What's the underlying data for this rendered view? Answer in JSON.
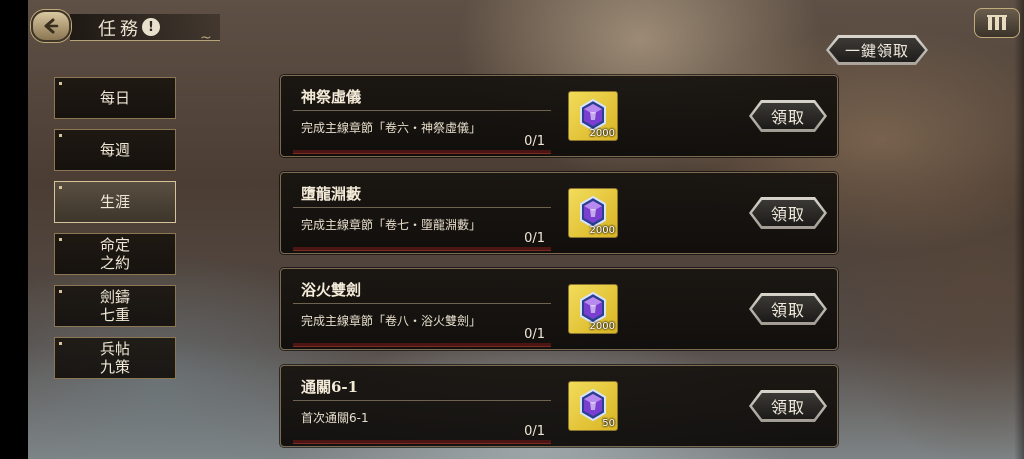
{
  "header": {
    "title": "任務",
    "info_icon": "!"
  },
  "toolbar": {
    "claim_all_label": "一鍵領取"
  },
  "sidebar": {
    "tabs": [
      {
        "label": "每日",
        "active": false
      },
      {
        "label": "每週",
        "active": false
      },
      {
        "label": "生涯",
        "active": true
      },
      {
        "label": "命定\n之約",
        "active": false
      },
      {
        "label": "劍鑄\n七重",
        "active": false
      },
      {
        "label": "兵帖\n九策",
        "active": false
      }
    ]
  },
  "quests": [
    {
      "title": "神祭虛儀",
      "description": "完成主線章節「卷六・神祭虛儀」",
      "progress": "0/1",
      "progress_fraction": 0,
      "reward_count": "2000",
      "claim_label": "領取"
    },
    {
      "title": "墮龍淵藪",
      "description": "完成主線章節「卷七・墮龍淵藪」",
      "progress": "0/1",
      "progress_fraction": 0,
      "reward_count": "2000",
      "claim_label": "領取"
    },
    {
      "title": "浴火雙劍",
      "description": "完成主線章節「卷八・浴火雙劍」",
      "progress": "0/1",
      "progress_fraction": 0,
      "reward_count": "2000",
      "claim_label": "領取"
    },
    {
      "title": "通關6-1",
      "description": "首次通關6-1",
      "progress": "0/1",
      "progress_fraction": 0,
      "reward_count": "50",
      "claim_label": "領取"
    }
  ],
  "icons": {
    "back": "back-arrow-icon",
    "menu": "menu-grid-icon",
    "reward": "purple-gem-icon"
  },
  "colors": {
    "reward_bg": "#e6c63a",
    "gem": "#7a3fd1",
    "progress_bar": "#c0392b"
  }
}
